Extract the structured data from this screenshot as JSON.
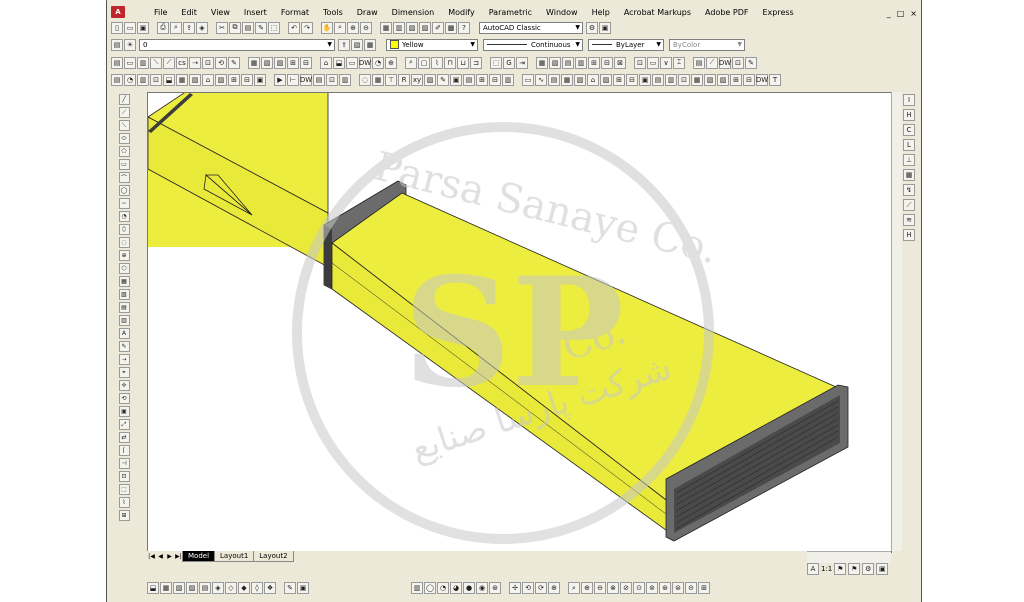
{
  "app": {
    "logo_text": "A",
    "menu": [
      "File",
      "Edit",
      "View",
      "Insert",
      "Format",
      "Tools",
      "Draw",
      "Dimension",
      "Modify",
      "Parametric",
      "Window",
      "Help",
      "Acrobat Markups",
      "Adobe PDF",
      "Express"
    ],
    "window_controls": [
      "_",
      "□",
      "×"
    ]
  },
  "toolbar": {
    "workspace": "AutoCAD Classic",
    "layer": "0",
    "color": "Yellow",
    "linetype": "Continuous",
    "lineweight": "ByLayer",
    "plotstyle": "ByColor",
    "text_style_hint": "cs",
    "dw_label": "DW",
    "r_label": "R",
    "xy_label": "xy",
    "g_label": "G",
    "t_label": "T"
  },
  "left_tools": [
    "╱",
    "⟋",
    "⟍",
    "⬭",
    "⬠",
    "▭",
    "⌒",
    "◯",
    "~",
    "◔",
    "⬯",
    "◌",
    "⊕",
    "⬡",
    "▦",
    "▧",
    "▤",
    "▥",
    "A",
    "✎",
    "⇢",
    "⌖",
    "✢",
    "⟲",
    "▣",
    "⤢",
    "⇄",
    "⌈",
    "⊣",
    "⊡",
    "⬚",
    "⌇",
    "⊞"
  ],
  "right_tools": [
    "I",
    "H",
    "C",
    "L",
    "⊥",
    "▦",
    "↯",
    "⟋",
    "≋",
    "H"
  ],
  "tabs": [
    "Model",
    "Layout1",
    "Layout2"
  ],
  "tab_nav": [
    "|◀",
    "◀",
    "▶",
    "▶|"
  ],
  "status": {
    "scale": "1:1",
    "annot": "A"
  },
  "watermark": {
    "text": "Parsa Sanaye Co.",
    "logo_letters": "SP",
    "co_text": "Co.",
    "persian_text": "شرکت پارسا صنایع"
  },
  "colors": {
    "duct_fill": "#eded3f",
    "duct_side": "#e9e93a",
    "duct_stroke": "#222222",
    "flange": "#6b6b6b",
    "flange_dark": "#3c3c3c",
    "watermark": "#c8c8c8"
  }
}
